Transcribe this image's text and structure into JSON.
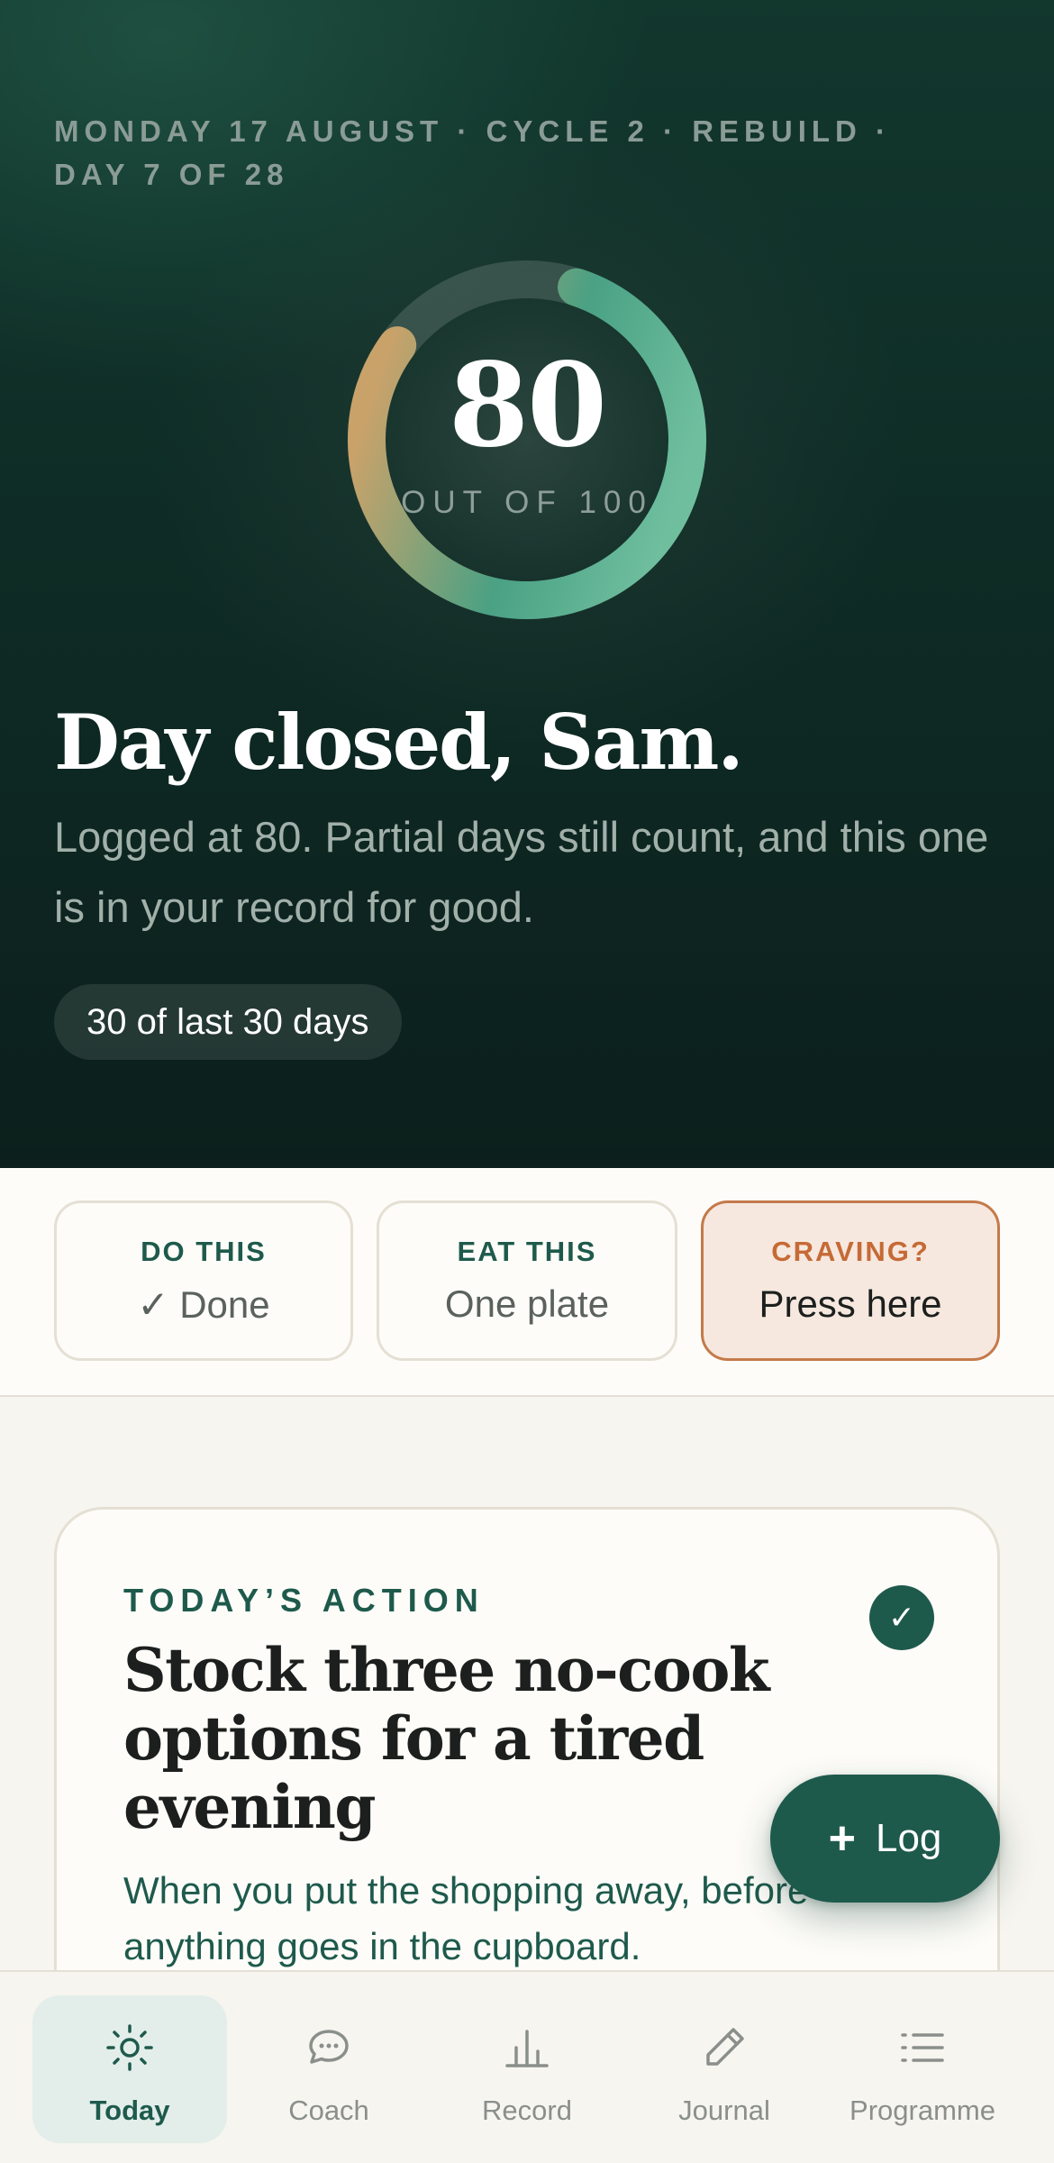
{
  "hero": {
    "meta_line": "MONDAY 17 AUGUST · CYCLE 2 · REBUILD · DAY 7 OF 28",
    "score": "80",
    "score_max_label": "OUT OF 100",
    "score_fraction": 0.8,
    "greeting": "Day closed, Sam.",
    "subtext": "Logged at 80. Partial days still count, and this one is in your record for good.",
    "streak": "30 of last 30 days"
  },
  "quick_actions": [
    {
      "label": "DO THIS",
      "value": "✓ Done"
    },
    {
      "label": "EAT THIS",
      "value": "One plate"
    },
    {
      "label": "CRAVING?",
      "value": "Press here"
    }
  ],
  "action_card": {
    "kicker": "TODAY’S ACTION",
    "title": "Stock three no-cook options for a tired evening",
    "description": "When you put the shopping away, before anything goes in the cupboard.",
    "completed": true
  },
  "fab": {
    "label": "Log",
    "icon": "plus-icon"
  },
  "tabs": [
    {
      "label": "Today",
      "icon": "sun-icon",
      "active": true
    },
    {
      "label": "Coach",
      "icon": "chat-icon",
      "active": false
    },
    {
      "label": "Record",
      "icon": "bar-chart-icon",
      "active": false
    },
    {
      "label": "Journal",
      "icon": "pencil-icon",
      "active": false
    },
    {
      "label": "Programme",
      "icon": "list-icon",
      "active": false
    }
  ],
  "colors": {
    "brand_green": "#1e5a4c",
    "hero_dark": "#0e2c25",
    "accent_orange": "#c66a36",
    "ring_start": "#c9a26a",
    "ring_end": "#6fbf9f"
  }
}
